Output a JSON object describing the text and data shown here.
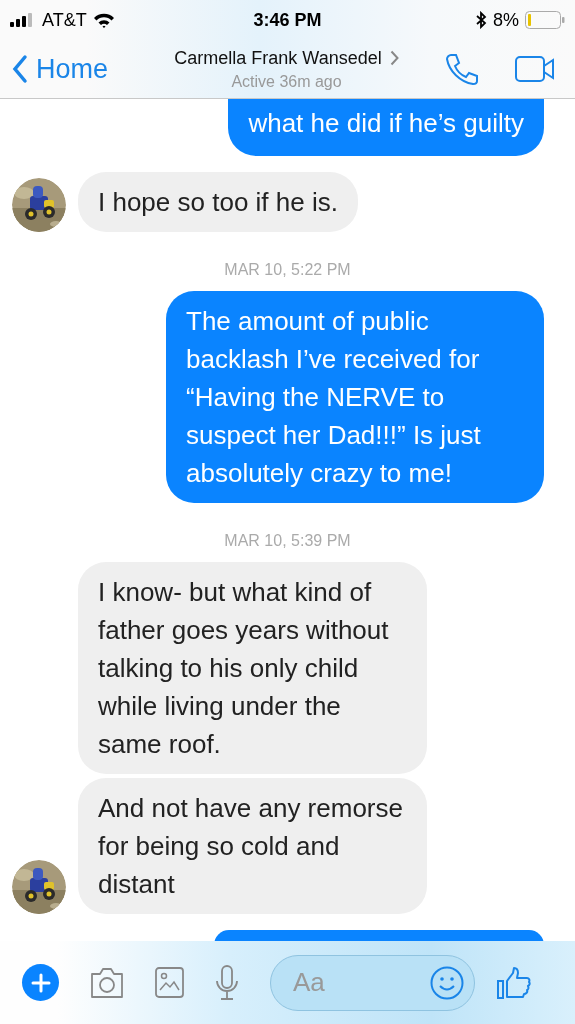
{
  "status_bar": {
    "carrier": "AT&T",
    "time": "3:46 PM",
    "battery": "8%"
  },
  "header": {
    "back_label": "Home",
    "title": "Carmella Frank Wansedel",
    "subtitle": "Active 36m ago"
  },
  "messages": [
    {
      "kind": "sent",
      "text": "what he did if he’s guilty",
      "cut_top": true
    },
    {
      "kind": "received",
      "text": "I hope so too if he is.",
      "avatar": true
    },
    {
      "kind": "timestamp",
      "text": "MAR 10, 5:22 PM"
    },
    {
      "kind": "sent",
      "text": "The amount of public backlash I’ve received for “Having the NERVE to suspect her Dad!!!” Is just absolutely crazy to me!",
      "cut_top": false
    },
    {
      "kind": "timestamp",
      "text": "MAR 10, 5:39 PM"
    },
    {
      "kind": "received",
      "text": "I know- but what kind of father goes years without talking to his only child while living under the same roof.",
      "avatar": false
    },
    {
      "kind": "received",
      "text": "And not have any remorse for being so cold and distant",
      "avatar": true
    },
    {
      "kind": "sent"
    }
  ],
  "composer": {
    "placeholder": "Aa"
  }
}
